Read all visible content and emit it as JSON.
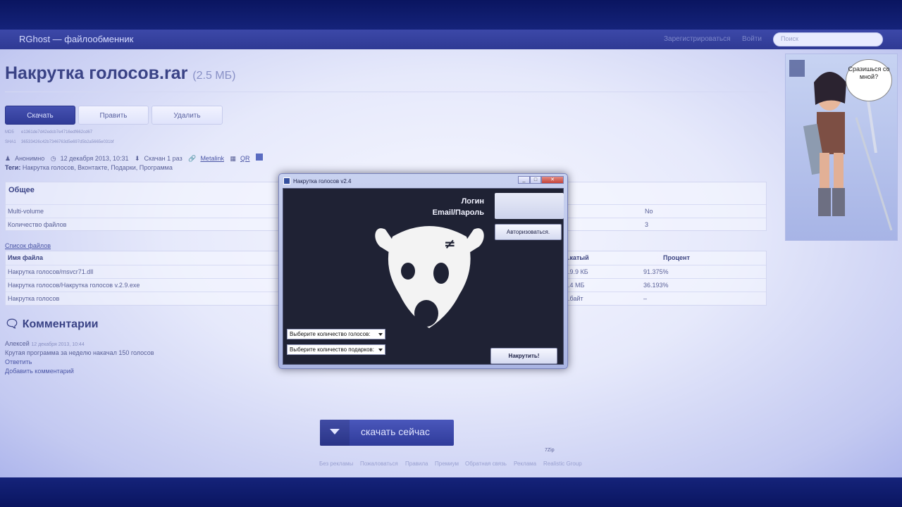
{
  "site": {
    "brand": "RGhost — файлообменник",
    "nav": {
      "register": "Зарегистрироваться",
      "login": "Войти"
    },
    "search_placeholder": "Поиск"
  },
  "file": {
    "title": "Накрутка голосов.rar",
    "size": "(2.5 МБ)",
    "buttons": {
      "download": "Скачать",
      "edit": "Править",
      "delete": "Удалить"
    },
    "md5_label": "MD5",
    "md5": "e1361de7d42edcb7e4716edf662cd67",
    "sha1_label": "SHA1",
    "sha1": "36533426c42b7346763d5e697d5b2a5665e031bf",
    "author": "Анонимно",
    "date": "12 декабря 2013, 10:31",
    "downloads": "Скачан 1 раз",
    "metalink": "Metalink",
    "qr": "QR",
    "tags_label": "Теги:",
    "tags": "Накрутка голосов, Вконтакте, Подарки, Программа"
  },
  "general": {
    "heading": "Общее",
    "rows": [
      {
        "key": "Multi-volume",
        "value": "No"
      },
      {
        "key": "Количество файлов",
        "value": "3"
      }
    ]
  },
  "files": {
    "link": "Список файлов",
    "headers": {
      "name": "Имя файла",
      "packed": "...катый",
      "percent": "Процент"
    },
    "rows": [
      {
        "name": "Накрутка голосов/msvcr71.dll",
        "packed": "...9.9 КБ",
        "percent": "91.375%"
      },
      {
        "name": "Накрутка голосов/Накрутка голосов v.2.9.exe",
        "packed": "...4 МБ",
        "percent": "36.193%"
      },
      {
        "name": "Накрутка голосов",
        "packed": "...байт",
        "percent": "–"
      }
    ]
  },
  "comments": {
    "heading": "Комментарии",
    "author": "Алексей",
    "time": "12 декабря 2013, 10:44",
    "text": "Крутая программа за неделю накачал 150 голосов",
    "reply": "Ответить",
    "add": "Добавить комментарий"
  },
  "download_now": "скачать сейчас",
  "zip_label": "7Zip",
  "footer": [
    "Без рекламы",
    "Пожаловаться",
    "Правила",
    "Премиум",
    "Обратная связь",
    "Реклама",
    "Realistic Group"
  ],
  "ad": {
    "bubble": "Сразишься со мной?"
  },
  "dialog": {
    "title": "Накрутка голосов v2.4",
    "login_label": "Логин",
    "email_label": "Email/Пароль",
    "auth_button": "Авторизоваться.",
    "select_votes": "Выберите количество голосов:",
    "select_gifts": "Выберите количество подарков:",
    "start_button": "Накрутить!"
  },
  "colors": {
    "accent": "#3a4386",
    "dialog_bg": "#1f2234",
    "primary_button": "#303b97"
  }
}
